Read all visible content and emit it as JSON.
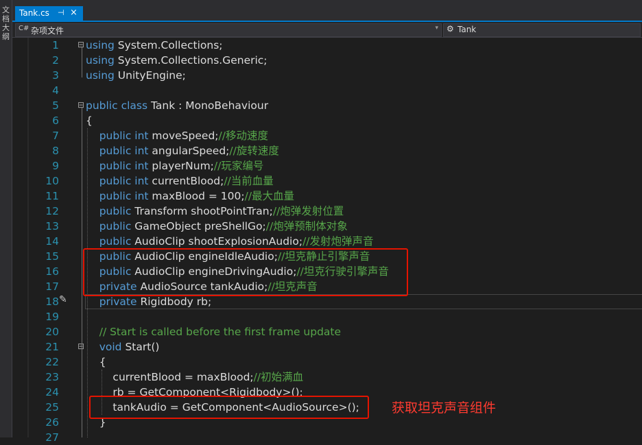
{
  "sidebar": {
    "label": "文档大纲"
  },
  "tab": {
    "label": "Tank.cs",
    "pin": "⊣",
    "close": "×"
  },
  "navbar": {
    "scope": "杂项文件",
    "symbol": "Tank"
  },
  "colors": {
    "keyword": "#569cd6",
    "comment": "#57a64a",
    "plain": "#dcdcdc",
    "line_number": "#2b91af",
    "accent": "#007acc",
    "highlight_box": "#e51400"
  },
  "lines": [
    {
      "n": "1",
      "parts": [
        [
          "kw",
          "using"
        ],
        [
          "ty",
          " System.Collections;"
        ]
      ]
    },
    {
      "n": "2",
      "parts": [
        [
          "kw",
          "using"
        ],
        [
          "ty",
          " System.Collections.Generic;"
        ]
      ]
    },
    {
      "n": "3",
      "parts": [
        [
          "kw",
          "using"
        ],
        [
          "ty",
          " UnityEngine;"
        ]
      ]
    },
    {
      "n": "4",
      "parts": []
    },
    {
      "n": "5",
      "parts": [
        [
          "kw",
          "public class"
        ],
        [
          "ty",
          " Tank : MonoBehaviour"
        ]
      ]
    },
    {
      "n": "6",
      "parts": [
        [
          "ty",
          "{"
        ]
      ]
    },
    {
      "n": "7",
      "parts": [
        [
          "ty",
          "    "
        ],
        [
          "kw",
          "public int"
        ],
        [
          "ty",
          " moveSpeed;"
        ],
        [
          "cm",
          "//移动速度"
        ]
      ]
    },
    {
      "n": "8",
      "parts": [
        [
          "ty",
          "    "
        ],
        [
          "kw",
          "public int"
        ],
        [
          "ty",
          " angularSpeed;"
        ],
        [
          "cm",
          "//旋转速度"
        ]
      ]
    },
    {
      "n": "9",
      "parts": [
        [
          "ty",
          "    "
        ],
        [
          "kw",
          "public int"
        ],
        [
          "ty",
          " playerNum;"
        ],
        [
          "cm",
          "//玩家编号"
        ]
      ]
    },
    {
      "n": "10",
      "parts": [
        [
          "ty",
          "    "
        ],
        [
          "kw",
          "public int"
        ],
        [
          "ty",
          " currentBlood;"
        ],
        [
          "cm",
          "//当前血量"
        ]
      ]
    },
    {
      "n": "11",
      "parts": [
        [
          "ty",
          "    "
        ],
        [
          "kw",
          "public int"
        ],
        [
          "ty",
          " maxBlood = 100;"
        ],
        [
          "cm",
          "//最大血量"
        ]
      ]
    },
    {
      "n": "12",
      "parts": [
        [
          "ty",
          "    "
        ],
        [
          "kw",
          "public"
        ],
        [
          "ty",
          " Transform shootPointTran;"
        ],
        [
          "cm",
          "//炮弹发射位置"
        ]
      ]
    },
    {
      "n": "13",
      "parts": [
        [
          "ty",
          "    "
        ],
        [
          "kw",
          "public"
        ],
        [
          "ty",
          " GameObject preShellGo;"
        ],
        [
          "cm",
          "//炮弹预制体对象"
        ]
      ]
    },
    {
      "n": "14",
      "parts": [
        [
          "ty",
          "    "
        ],
        [
          "kw",
          "public"
        ],
        [
          "ty",
          " AudioClip shootExplosionAudio;"
        ],
        [
          "cm",
          "//发射炮弹声音"
        ]
      ]
    },
    {
      "n": "15",
      "parts": [
        [
          "ty",
          "    "
        ],
        [
          "kw",
          "public"
        ],
        [
          "ty",
          " AudioClip engineIdleAudio;"
        ],
        [
          "cm",
          "//坦克静止引擎声音"
        ]
      ]
    },
    {
      "n": "16",
      "parts": [
        [
          "ty",
          "    "
        ],
        [
          "kw",
          "public"
        ],
        [
          "ty",
          " AudioClip engineDrivingAudio;"
        ],
        [
          "cm",
          "//坦克行驶引擎声音"
        ]
      ]
    },
    {
      "n": "17",
      "parts": [
        [
          "ty",
          "    "
        ],
        [
          "kw",
          "private"
        ],
        [
          "ty",
          " AudioSource tankAudio;"
        ],
        [
          "cm",
          "//坦克声音"
        ]
      ]
    },
    {
      "n": "18",
      "parts": [
        [
          "ty",
          "    "
        ],
        [
          "kw",
          "private"
        ],
        [
          "ty",
          " Rigidbody rb;"
        ]
      ]
    },
    {
      "n": "19",
      "parts": []
    },
    {
      "n": "20",
      "parts": [
        [
          "ty",
          "    "
        ],
        [
          "cm",
          "// Start is called before the first frame update"
        ]
      ]
    },
    {
      "n": "21",
      "parts": [
        [
          "ty",
          "    "
        ],
        [
          "kw",
          "void"
        ],
        [
          "ty",
          " Start()"
        ]
      ]
    },
    {
      "n": "22",
      "parts": [
        [
          "ty",
          "    {"
        ]
      ]
    },
    {
      "n": "23",
      "parts": [
        [
          "ty",
          "        currentBlood = maxBlood;"
        ],
        [
          "cm",
          "//初始满血"
        ]
      ]
    },
    {
      "n": "24",
      "parts": [
        [
          "ty",
          "        rb = GetComponent<Rigidbody>();"
        ]
      ]
    },
    {
      "n": "25",
      "parts": [
        [
          "ty",
          "        tankAudio = GetComponent<AudioSource>();"
        ]
      ]
    },
    {
      "n": "26",
      "parts": [
        [
          "ty",
          "    }"
        ]
      ]
    },
    {
      "n": "27",
      "parts": []
    }
  ],
  "annotation": "获取坦克声音组件"
}
